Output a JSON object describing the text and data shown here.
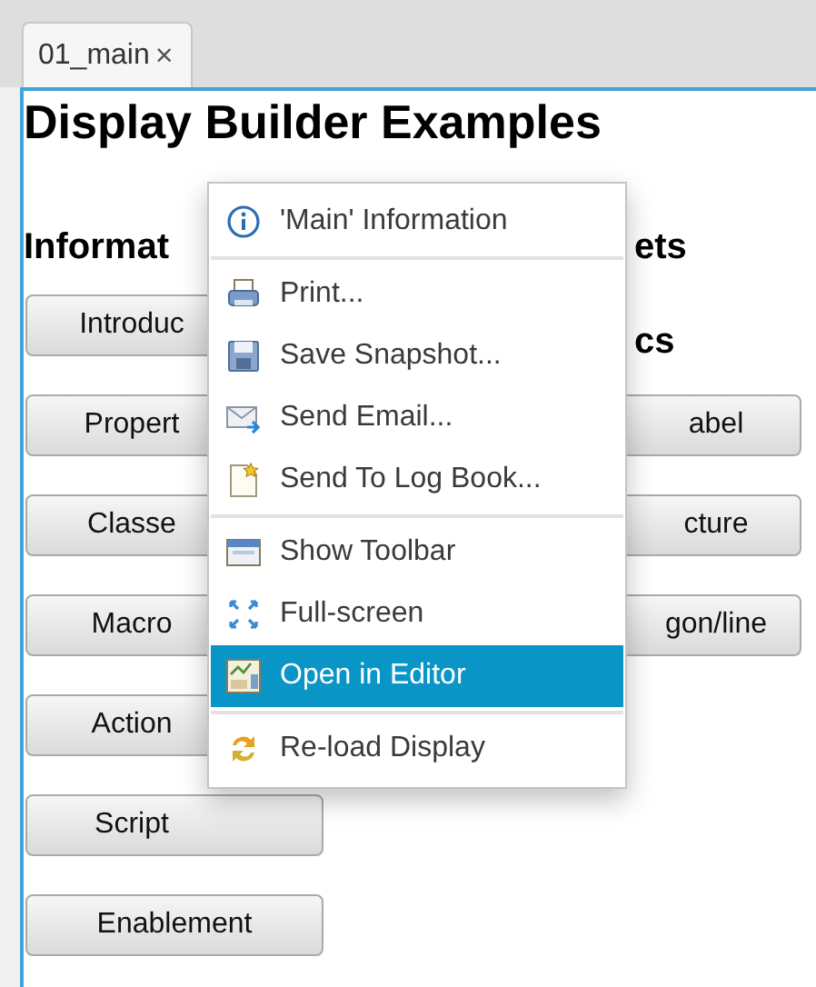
{
  "tab": {
    "label": "01_main",
    "close": "×",
    "selected": true
  },
  "title": "Display Builder Examples",
  "left_column": {
    "heading": "Informat",
    "buttons": [
      "Introduc",
      "Propert",
      "Classe",
      "Macro",
      "Action",
      "Script",
      "Enablement"
    ]
  },
  "right_column": {
    "headings": [
      "ets",
      "cs"
    ],
    "buttons": [
      "abel",
      "cture",
      "gon/line"
    ]
  },
  "context_menu": {
    "groups": [
      [
        {
          "label": "'Main' Information",
          "selected": false
        }
      ],
      [
        {
          "label": "Print...",
          "selected": false
        },
        {
          "label": "Save Snapshot...",
          "selected": false
        },
        {
          "label": "Send Email...",
          "selected": false
        },
        {
          "label": "Send To Log Book...",
          "selected": false
        }
      ],
      [
        {
          "label": "Show Toolbar",
          "selected": false
        },
        {
          "label": "Full-screen",
          "selected": false
        },
        {
          "label": "Open in Editor",
          "selected": true
        }
      ],
      [
        {
          "label": "Re-load Display",
          "selected": false
        }
      ]
    ]
  }
}
